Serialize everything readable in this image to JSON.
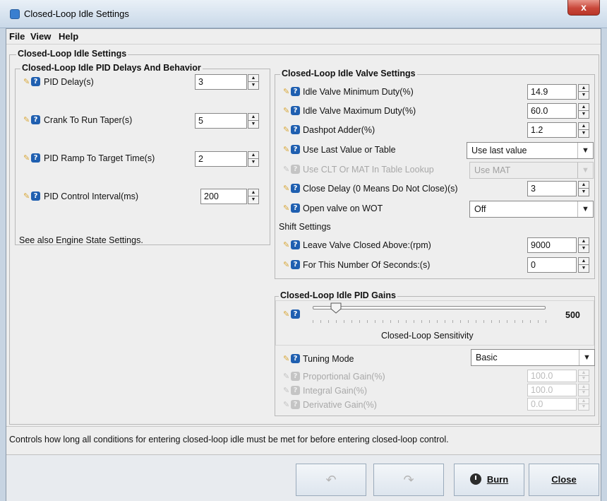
{
  "window": {
    "title": "Closed-Loop Idle Settings",
    "close_glyph": "x"
  },
  "menu": {
    "file": "File",
    "view": "View",
    "help": "Help"
  },
  "main": {
    "title": "Closed-Loop Idle Settings"
  },
  "pid_delays": {
    "title": "Closed-Loop Idle PID Delays And Behavior",
    "rows": [
      {
        "label": "PID Delay(s)",
        "value": "3"
      },
      {
        "label": "Crank To Run Taper(s)",
        "value": "5"
      },
      {
        "label": "PID Ramp To Target Time(s)",
        "value": "2"
      },
      {
        "label": "PID Control Interval(ms)",
        "value": "200"
      }
    ],
    "note": "See also Engine State Settings."
  },
  "valve_settings": {
    "title": "Closed-Loop Idle Valve Settings",
    "min_duty": {
      "label": "Idle Valve Minimum Duty(%)",
      "value": "14.9"
    },
    "max_duty": {
      "label": "Idle Valve Maximum Duty(%)",
      "value": "60.0"
    },
    "dashpot": {
      "label": "Dashpot Adder(%)",
      "value": "1.2"
    },
    "use_last": {
      "label": "Use Last Value or Table",
      "value": "Use last value"
    },
    "clt_mat": {
      "label": "Use CLT Or MAT In Table Lookup",
      "value": "Use MAT"
    },
    "close_delay": {
      "label": "Close Delay (0 Means Do Not Close)(s)",
      "value": "3"
    },
    "open_wot": {
      "label": "Open valve on WOT",
      "value": "Off"
    },
    "shift_title": "Shift Settings",
    "leave_closed": {
      "label": "Leave Valve Closed Above:(rpm)",
      "value": "9000"
    },
    "seconds": {
      "label": "For This Number Of Seconds:(s)",
      "value": "0"
    }
  },
  "pid_gains": {
    "title": "Closed-Loop Idle PID Gains",
    "sensitivity_value": "500",
    "sensitivity_label": "Closed-Loop Sensitivity",
    "sensitivity_level": 0.1,
    "tuning_mode": {
      "label": "Tuning Mode",
      "value": "Basic"
    },
    "proportional": {
      "label": "Proportional Gain(%)",
      "value": "100.0"
    },
    "integral": {
      "label": "Integral Gain(%)",
      "value": "100.0"
    },
    "derivative": {
      "label": "Derivative Gain(%)",
      "value": "0.0"
    }
  },
  "status": "Controls how long all conditions for entering closed-loop idle must be met for before entering closed-loop control.",
  "buttons": {
    "burn": "Burn",
    "close": "Close",
    "undo_glyph": "↶",
    "redo_glyph": "↷"
  },
  "colors": {
    "help_icon": "#1f5fb0",
    "titlebar_close": "#c9473a"
  }
}
